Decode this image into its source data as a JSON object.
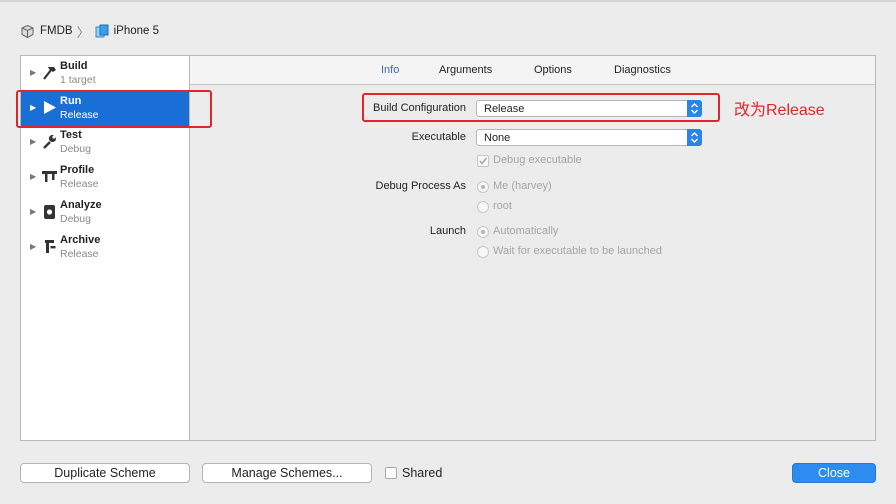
{
  "breadcrumb": {
    "project": "FMDB",
    "device": "iPhone 5"
  },
  "sidebar": {
    "items": [
      {
        "title": "Build",
        "subtitle": "1 target",
        "icon": "hammer-icon",
        "selected": false
      },
      {
        "title": "Run",
        "subtitle": "Release",
        "icon": "play-icon",
        "selected": true
      },
      {
        "title": "Test",
        "subtitle": "Debug",
        "icon": "wrench-icon",
        "selected": false
      },
      {
        "title": "Profile",
        "subtitle": "Release",
        "icon": "caliper-icon",
        "selected": false
      },
      {
        "title": "Analyze",
        "subtitle": "Debug",
        "icon": "analyze-icon",
        "selected": false
      },
      {
        "title": "Archive",
        "subtitle": "Release",
        "icon": "archive-icon",
        "selected": false
      }
    ]
  },
  "tabs": [
    "Info",
    "Arguments",
    "Options",
    "Diagnostics"
  ],
  "active_tab": "Info",
  "info": {
    "build_configuration_label": "Build Configuration",
    "build_configuration_value": "Release",
    "executable_label": "Executable",
    "executable_value": "None",
    "debug_executable_label": "Debug executable",
    "debug_process_as_label": "Debug Process As",
    "debug_process_options": [
      "Me (harvey)",
      "root"
    ],
    "launch_label": "Launch",
    "launch_options": [
      "Automatically",
      "Wait for executable to be launched"
    ]
  },
  "annotation": "改为Release",
  "footer": {
    "duplicate_label": "Duplicate Scheme",
    "manage_label": "Manage Schemes...",
    "shared_label": "Shared",
    "close_label": "Close"
  },
  "colors": {
    "selection": "#1a6fd6",
    "accent": "#2d8cf0",
    "annotation": "#e0262b"
  }
}
